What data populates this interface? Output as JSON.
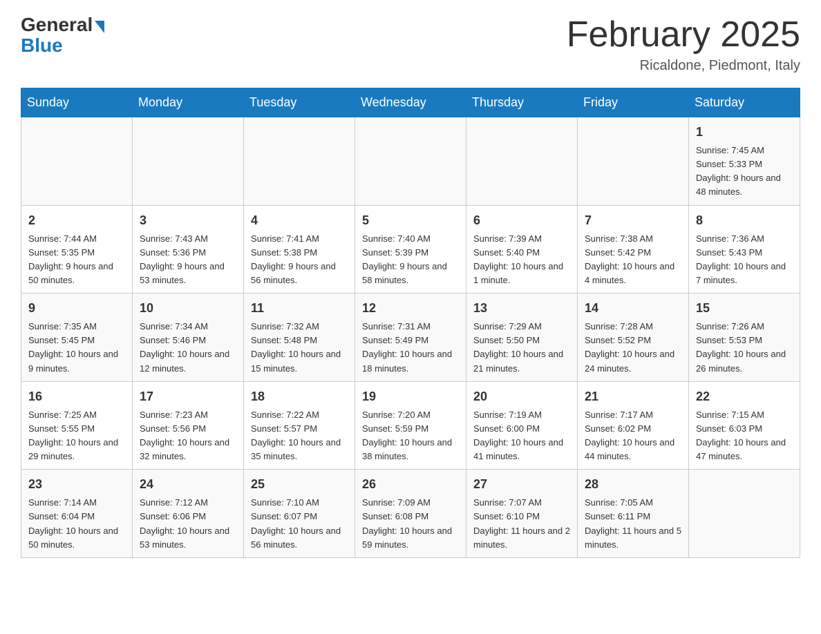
{
  "header": {
    "logo_general": "General",
    "logo_blue": "Blue",
    "month_title": "February 2025",
    "location": "Ricaldone, Piedmont, Italy"
  },
  "days_of_week": [
    "Sunday",
    "Monday",
    "Tuesday",
    "Wednesday",
    "Thursday",
    "Friday",
    "Saturday"
  ],
  "weeks": [
    [
      {
        "day": "",
        "info": ""
      },
      {
        "day": "",
        "info": ""
      },
      {
        "day": "",
        "info": ""
      },
      {
        "day": "",
        "info": ""
      },
      {
        "day": "",
        "info": ""
      },
      {
        "day": "",
        "info": ""
      },
      {
        "day": "1",
        "info": "Sunrise: 7:45 AM\nSunset: 5:33 PM\nDaylight: 9 hours and 48 minutes."
      }
    ],
    [
      {
        "day": "2",
        "info": "Sunrise: 7:44 AM\nSunset: 5:35 PM\nDaylight: 9 hours and 50 minutes."
      },
      {
        "day": "3",
        "info": "Sunrise: 7:43 AM\nSunset: 5:36 PM\nDaylight: 9 hours and 53 minutes."
      },
      {
        "day": "4",
        "info": "Sunrise: 7:41 AM\nSunset: 5:38 PM\nDaylight: 9 hours and 56 minutes."
      },
      {
        "day": "5",
        "info": "Sunrise: 7:40 AM\nSunset: 5:39 PM\nDaylight: 9 hours and 58 minutes."
      },
      {
        "day": "6",
        "info": "Sunrise: 7:39 AM\nSunset: 5:40 PM\nDaylight: 10 hours and 1 minute."
      },
      {
        "day": "7",
        "info": "Sunrise: 7:38 AM\nSunset: 5:42 PM\nDaylight: 10 hours and 4 minutes."
      },
      {
        "day": "8",
        "info": "Sunrise: 7:36 AM\nSunset: 5:43 PM\nDaylight: 10 hours and 7 minutes."
      }
    ],
    [
      {
        "day": "9",
        "info": "Sunrise: 7:35 AM\nSunset: 5:45 PM\nDaylight: 10 hours and 9 minutes."
      },
      {
        "day": "10",
        "info": "Sunrise: 7:34 AM\nSunset: 5:46 PM\nDaylight: 10 hours and 12 minutes."
      },
      {
        "day": "11",
        "info": "Sunrise: 7:32 AM\nSunset: 5:48 PM\nDaylight: 10 hours and 15 minutes."
      },
      {
        "day": "12",
        "info": "Sunrise: 7:31 AM\nSunset: 5:49 PM\nDaylight: 10 hours and 18 minutes."
      },
      {
        "day": "13",
        "info": "Sunrise: 7:29 AM\nSunset: 5:50 PM\nDaylight: 10 hours and 21 minutes."
      },
      {
        "day": "14",
        "info": "Sunrise: 7:28 AM\nSunset: 5:52 PM\nDaylight: 10 hours and 24 minutes."
      },
      {
        "day": "15",
        "info": "Sunrise: 7:26 AM\nSunset: 5:53 PM\nDaylight: 10 hours and 26 minutes."
      }
    ],
    [
      {
        "day": "16",
        "info": "Sunrise: 7:25 AM\nSunset: 5:55 PM\nDaylight: 10 hours and 29 minutes."
      },
      {
        "day": "17",
        "info": "Sunrise: 7:23 AM\nSunset: 5:56 PM\nDaylight: 10 hours and 32 minutes."
      },
      {
        "day": "18",
        "info": "Sunrise: 7:22 AM\nSunset: 5:57 PM\nDaylight: 10 hours and 35 minutes."
      },
      {
        "day": "19",
        "info": "Sunrise: 7:20 AM\nSunset: 5:59 PM\nDaylight: 10 hours and 38 minutes."
      },
      {
        "day": "20",
        "info": "Sunrise: 7:19 AM\nSunset: 6:00 PM\nDaylight: 10 hours and 41 minutes."
      },
      {
        "day": "21",
        "info": "Sunrise: 7:17 AM\nSunset: 6:02 PM\nDaylight: 10 hours and 44 minutes."
      },
      {
        "day": "22",
        "info": "Sunrise: 7:15 AM\nSunset: 6:03 PM\nDaylight: 10 hours and 47 minutes."
      }
    ],
    [
      {
        "day": "23",
        "info": "Sunrise: 7:14 AM\nSunset: 6:04 PM\nDaylight: 10 hours and 50 minutes."
      },
      {
        "day": "24",
        "info": "Sunrise: 7:12 AM\nSunset: 6:06 PM\nDaylight: 10 hours and 53 minutes."
      },
      {
        "day": "25",
        "info": "Sunrise: 7:10 AM\nSunset: 6:07 PM\nDaylight: 10 hours and 56 minutes."
      },
      {
        "day": "26",
        "info": "Sunrise: 7:09 AM\nSunset: 6:08 PM\nDaylight: 10 hours and 59 minutes."
      },
      {
        "day": "27",
        "info": "Sunrise: 7:07 AM\nSunset: 6:10 PM\nDaylight: 11 hours and 2 minutes."
      },
      {
        "day": "28",
        "info": "Sunrise: 7:05 AM\nSunset: 6:11 PM\nDaylight: 11 hours and 5 minutes."
      },
      {
        "day": "",
        "info": ""
      }
    ]
  ]
}
